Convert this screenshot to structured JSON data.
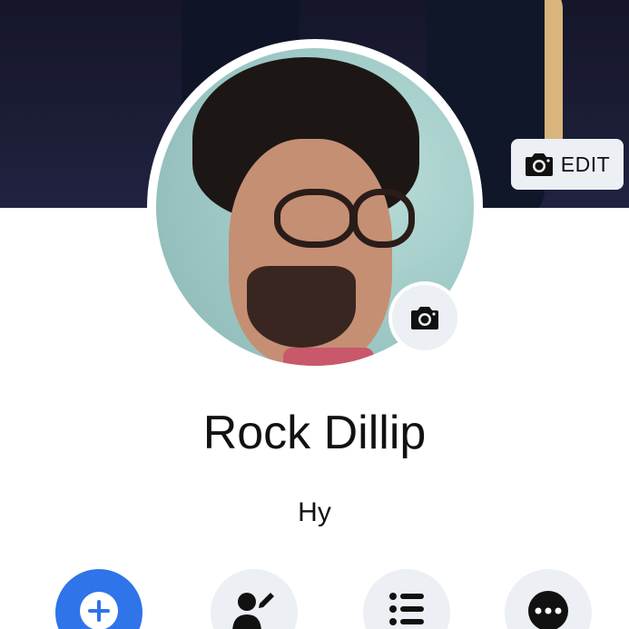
{
  "profile": {
    "name": "Rock Dillip",
    "bio": "Hy"
  },
  "cover": {
    "edit_label": "EDIT",
    "edit_icon": "camera-icon"
  },
  "avatar": {
    "camera_icon": "camera-icon"
  },
  "actions": [
    {
      "icon": "add-circle-icon"
    },
    {
      "icon": "edit-profile-icon"
    },
    {
      "icon": "list-icon"
    },
    {
      "icon": "more-icon"
    }
  ],
  "colors": {
    "accent": "#2f74e8",
    "button_bg": "#eceff3",
    "text": "#111111"
  }
}
